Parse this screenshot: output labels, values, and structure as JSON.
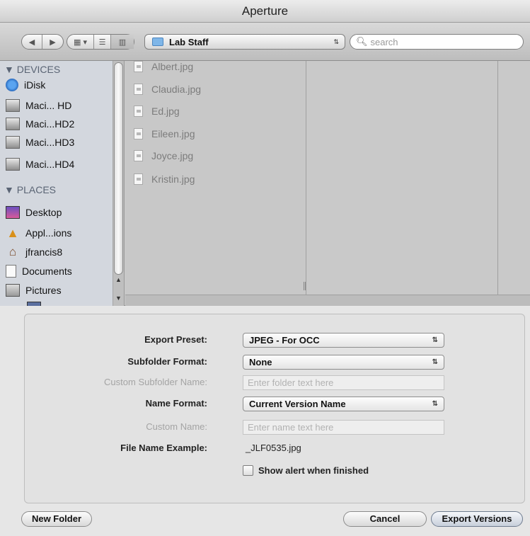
{
  "window": {
    "title": "Aperture"
  },
  "toolbar": {
    "location": "Lab Staff",
    "search_placeholder": "search"
  },
  "sidebar": {
    "devices_header": "DEVICES",
    "devices": [
      {
        "label": "iDisk",
        "icon": "idisk-icon"
      },
      {
        "label": "Maci... HD",
        "icon": "hard-drive-icon"
      },
      {
        "label": "Maci...HD2",
        "icon": "hard-drive-icon"
      },
      {
        "label": "Maci...HD3",
        "icon": "hard-drive-icon"
      },
      {
        "label": "Maci...HD4",
        "icon": "hard-drive-icon"
      }
    ],
    "places_header": "PLACES",
    "places": [
      {
        "label": "Desktop",
        "icon": "desktop-icon"
      },
      {
        "label": "Appl...ions",
        "icon": "applications-icon"
      },
      {
        "label": "jfrancis8",
        "icon": "home-icon"
      },
      {
        "label": "Documents",
        "icon": "documents-icon"
      },
      {
        "label": "Pictures",
        "icon": "pictures-icon"
      }
    ]
  },
  "files": [
    {
      "name": "Albert.jpg"
    },
    {
      "name": "Claudia.jpg"
    },
    {
      "name": "Ed.jpg"
    },
    {
      "name": "Eileen.jpg"
    },
    {
      "name": "Joyce.jpg"
    },
    {
      "name": "Kristin.jpg"
    }
  ],
  "options": {
    "export_preset_label": "Export Preset:",
    "export_preset_value": "JPEG - For OCC",
    "subfolder_format_label": "Subfolder Format:",
    "subfolder_format_value": "None",
    "custom_subfolder_label": "Custom Subfolder Name:",
    "custom_subfolder_placeholder": "Enter folder text here",
    "name_format_label": "Name Format:",
    "name_format_value": "Current Version Name",
    "custom_name_label": "Custom Name:",
    "custom_name_placeholder": "Enter name text here",
    "file_name_example_label": "File Name Example:",
    "file_name_example_value": "_JLF0535.jpg",
    "show_alert_label": "Show alert when finished",
    "show_alert_checked": false
  },
  "buttons": {
    "new_folder": "New Folder",
    "cancel": "Cancel",
    "export": "Export Versions"
  },
  "colors": {
    "sidebar_bg": "#d3d7de",
    "browser_bg": "#c8c8c8",
    "panel_bg": "#e2e2e2"
  }
}
